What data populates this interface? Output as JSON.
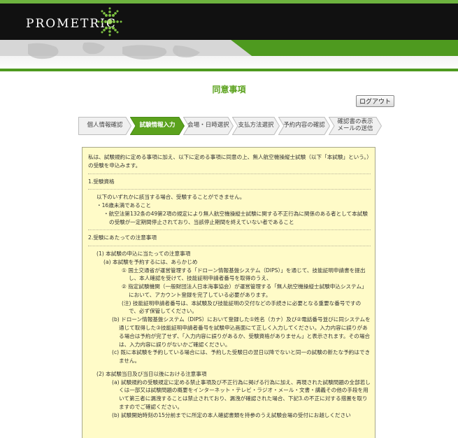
{
  "header": {
    "logo_text": "PROMETRIC"
  },
  "page": {
    "title": "同意事項",
    "logout_label": "ログアウト"
  },
  "steps": [
    {
      "label": "個人情報確認",
      "active": false
    },
    {
      "label": "試験情報入力",
      "active": true
    },
    {
      "label": "会場・日時選択",
      "active": false
    },
    {
      "label": "支払方法選択",
      "active": false
    },
    {
      "label": "予約内容の確認",
      "active": false
    },
    {
      "label1": "確認書の表示",
      "label2": "メールの送信",
      "active": false
    }
  ],
  "content": {
    "intro": "私は、試験規約に定める事項に加え、以下に定める事項に同意の上、無人航空機操縦士試験（以下「本試験」という。）の受験を申込みます。",
    "s1_heading": "1.受験資格",
    "s1_lead": "以下のいずれかに該当する場合、受験することができません。",
    "s1_item1": "・16歳未満であること",
    "s1_item2": "・航空法第132条の49第2項の規定により無人航空機操縦士試験に関する不正行為に関係のある者として本試験の受験が一定期間停止されており、当該停止期間を終えていない者であること",
    "s2_heading": "2.受験にあたっての注意事項",
    "s2_1": "(1) 本試験の申込に当たっての注意事項",
    "s2_1a": "(a) 本試験を予約するには、あらかじめ",
    "s2_1a_1": "① 国土交通省が運営管理する「ドローン情報基盤システム（DIPS）」を通じて、技能証明申請書を提出し、本人確認を受けて、技能証明申請者番号を取得のうえ、",
    "s2_1a_2": "② 指定試験機関（一般財団法人日本海事協会）が運営管理する「無人航空機操縦士試験申込システム」において、アカウント登録を完了している必要があります。",
    "s2_1a_note": "(注) 技能証明申請者番号は、本試験及び技能証明の交付などの手続きに必要となる重要な番号ですので、必ず保管してください。",
    "s2_1b": "(b) ドローン情報基盤システム（DIPS）において登録した①姓名（カナ）及び②電話番号並びに同システムを通じて取得した③技能証明申請者番号を試験申込画面にて正しく入力してください。入力内容に誤りがある場合は予約が完了せず、「入力内容に誤りがあるか、受験資格がありません」と表示されます。その場合は、入力内容に誤りがないかご確認ください。",
    "s2_1c": "(c) 既に本試験を予約している場合には、予約した受験日の翌日以降でないと同一の試験の新たな予約はできません。",
    "s2_2": "(2) 本試験当日及び当日以後における注意事項",
    "s2_2a": "(a) 試験規約の受験規定に定める禁止事項及び不正行為に掲げる行為に加え、再現された試験問題の全部若しくは一部又は試験問題の概要をインターネット・テレビ・ラジオ・メール・文書・講義その他の手段を用いて第三者に漏洩することは禁止されており、漏洩が確認された場合、下記3.の不正に対する措置を取りますのでご確認ください。",
    "s2_2b": "(b) 試験開始時刻の15分前までに所定の本人確認書類を持参のうえ試験会場の受付にお越しください"
  }
}
